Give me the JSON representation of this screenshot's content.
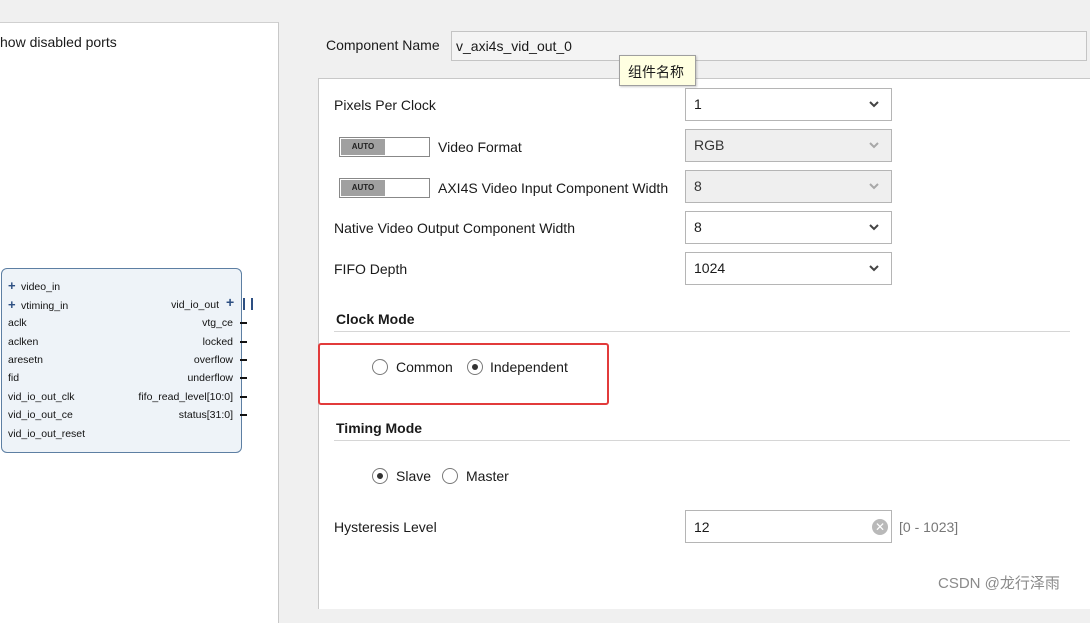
{
  "left_panel": {
    "show_disabled_ports": "how disabled ports",
    "ip_block": {
      "left_ports": [
        "video_in",
        "vtiming_in",
        "aclk",
        "aclken",
        "aresetn",
        "fid",
        "vid_io_out_clk",
        "vid_io_out_ce",
        "vid_io_out_reset"
      ],
      "left_bus_ports": [
        "video_in",
        "vtiming_in"
      ],
      "right_ports": [
        "vid_io_out",
        "vtg_ce",
        "locked",
        "overflow",
        "underflow",
        "fifo_read_level[10:0]",
        "status[31:0]"
      ]
    }
  },
  "component_name": {
    "label": "Component Name",
    "value": "v_axi4s_vid_out_0",
    "tooltip": "组件名称"
  },
  "params": {
    "pixels_per_clock": {
      "label": "Pixels Per Clock",
      "value": "1"
    },
    "video_format": {
      "label": "Video Format",
      "value": "RGB",
      "auto_label": "AUTO"
    },
    "axi4s_width": {
      "label": "AXI4S Video Input Component Width",
      "value": "8",
      "auto_label": "AUTO"
    },
    "native_width": {
      "label": "Native Video Output Component Width",
      "value": "8"
    },
    "fifo_depth": {
      "label": "FIFO Depth",
      "value": "1024"
    }
  },
  "clock_mode": {
    "title": "Clock Mode",
    "options": [
      "Common",
      "Independent"
    ],
    "selected": "Independent"
  },
  "timing_mode": {
    "title": "Timing Mode",
    "options": [
      "Slave",
      "Master"
    ],
    "selected": "Slave"
  },
  "hysteresis": {
    "label": "Hysteresis Level",
    "value": "12",
    "range": "[0 - 1023]",
    "clear_glyph": "✕"
  },
  "watermark": "CSDN @龙行泽雨",
  "colors": {
    "highlight_box": "#e23b3b",
    "ip_block_border": "#5d7fa3",
    "tooltip_bg": "#ffffe1"
  }
}
